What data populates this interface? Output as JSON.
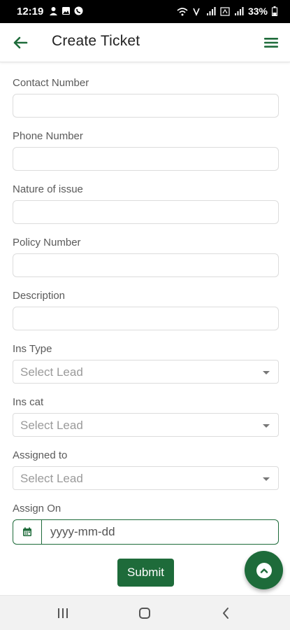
{
  "status_bar": {
    "time": "12:19",
    "battery": "33%"
  },
  "app_bar": {
    "title": "Create Ticket",
    "back_icon": "arrow-left-icon",
    "menu_icon": "hamburger-menu-icon"
  },
  "form": {
    "fields": [
      {
        "label": "Contact Number",
        "value": "",
        "placeholder": ""
      },
      {
        "label": "Phone Number",
        "value": "",
        "placeholder": ""
      },
      {
        "label": "Nature of issue",
        "value": "",
        "placeholder": ""
      },
      {
        "label": "Policy Number",
        "value": "",
        "placeholder": ""
      },
      {
        "label": "Description",
        "value": "",
        "placeholder": ""
      }
    ],
    "selects": [
      {
        "label": "Ins Type",
        "selected": "Select Lead"
      },
      {
        "label": "Ins cat",
        "selected": "Select Lead"
      },
      {
        "label": "Assigned to",
        "selected": "Select Lead"
      }
    ],
    "date": {
      "label": "Assign On",
      "placeholder": "yyyy-mm-dd",
      "icon": "calendar-icon"
    },
    "submit_label": "Submit"
  },
  "fab": {
    "icon": "chevron-up-icon"
  },
  "nav_bar": {
    "recents_icon": "recents-icon",
    "home_icon": "home-icon",
    "back_icon": "back-chevron-icon"
  },
  "colors": {
    "primary": "#1e6b3a",
    "status_bar": "#000000",
    "nav_bar": "#f2f2f2"
  }
}
